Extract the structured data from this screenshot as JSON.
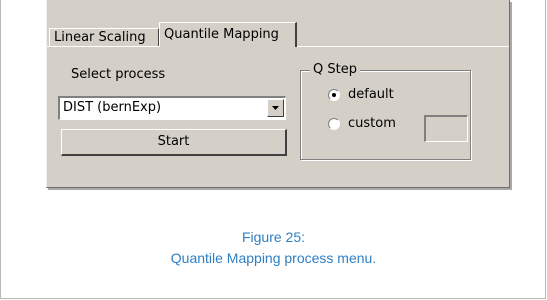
{
  "tabs": [
    {
      "label": "Linear Scaling",
      "active": false
    },
    {
      "label": "Quantile Mapping",
      "active": true
    }
  ],
  "process": {
    "label": "Select process",
    "selected": "DIST (bernExp)",
    "start_label": "Start"
  },
  "qstep": {
    "legend": "Q Step",
    "options": [
      {
        "label": "default",
        "checked": true
      },
      {
        "label": "custom",
        "checked": false
      }
    ],
    "custom_value": ""
  },
  "caption": {
    "line1": "Figure 25:",
    "line2": "Quantile Mapping process menu."
  },
  "colors": {
    "dialog_bg": "#d4d0c8",
    "caption": "#2e7fc3"
  },
  "icons": {
    "dropdown": "chevron-down-icon"
  }
}
